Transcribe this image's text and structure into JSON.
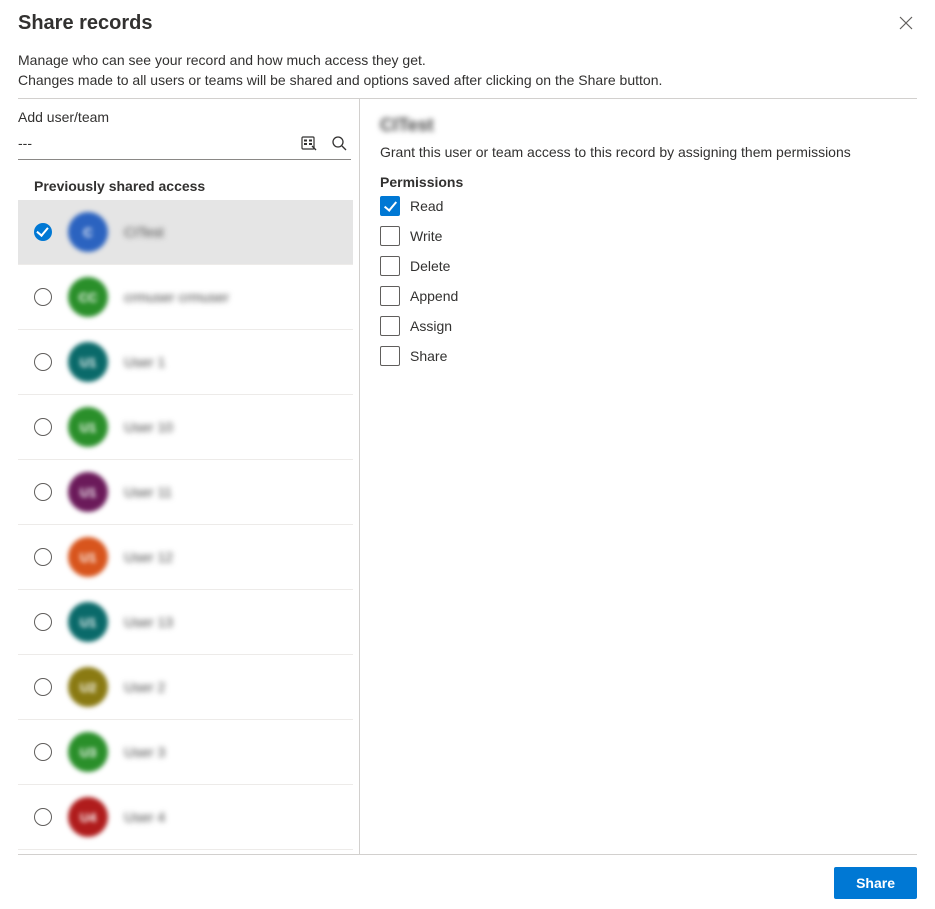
{
  "dialog": {
    "title": "Share records",
    "subtitle_line1": "Manage who can see your record and how much access they get.",
    "subtitle_line2": "Changes made to all users or teams will be shared and options saved after clicking on the Share button."
  },
  "add": {
    "label": "Add user/team",
    "value": "---"
  },
  "shared": {
    "heading": "Previously shared access",
    "users": [
      {
        "name": "CITest",
        "initials": "C",
        "color": "#2b63c0",
        "selected": true
      },
      {
        "name": "crmuser crmuser",
        "initials": "CC",
        "color": "#2a8f2a",
        "selected": false
      },
      {
        "name": "User 1",
        "initials": "U1",
        "color": "#0a6a6a",
        "selected": false
      },
      {
        "name": "User 10",
        "initials": "U1",
        "color": "#2a8f2a",
        "selected": false
      },
      {
        "name": "User 11",
        "initials": "U1",
        "color": "#6b1a5a",
        "selected": false
      },
      {
        "name": "User 12",
        "initials": "U1",
        "color": "#d8551d",
        "selected": false
      },
      {
        "name": "User 13",
        "initials": "U1",
        "color": "#0a6a6a",
        "selected": false
      },
      {
        "name": "User 2",
        "initials": "U2",
        "color": "#8a7a12",
        "selected": false
      },
      {
        "name": "User 3",
        "initials": "U3",
        "color": "#2a8f2a",
        "selected": false
      },
      {
        "name": "User 4",
        "initials": "U4",
        "color": "#b01c1c",
        "selected": false
      }
    ]
  },
  "detail": {
    "selected_name": "CITest",
    "description": "Grant this user or team access to this record by assigning them permissions",
    "permissions_heading": "Permissions",
    "permissions": [
      {
        "label": "Read",
        "checked": true
      },
      {
        "label": "Write",
        "checked": false
      },
      {
        "label": "Delete",
        "checked": false
      },
      {
        "label": "Append",
        "checked": false
      },
      {
        "label": "Assign",
        "checked": false
      },
      {
        "label": "Share",
        "checked": false
      }
    ]
  },
  "footer": {
    "share_label": "Share"
  }
}
